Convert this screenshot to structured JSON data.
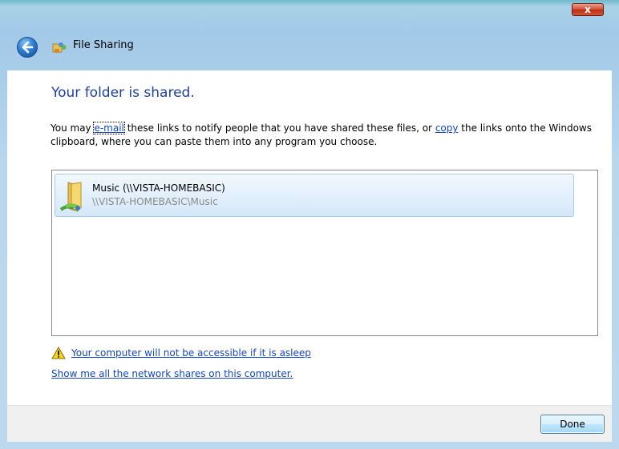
{
  "window": {
    "title": "File Sharing",
    "close_label": "x"
  },
  "main": {
    "heading": "Your folder is shared.",
    "description": {
      "part1": "You may ",
      "email_link": "e-mail",
      "part2": " these links to notify people that you have shared these files, or ",
      "copy_link": "copy",
      "part3": " the links onto the Windows clipboard, where you can paste them into any program you choose."
    },
    "shared_items": [
      {
        "name": "Music (\\\\VISTA-HOMEBASIC)",
        "path": "\\\\VISTA-HOMEBASIC\\Music",
        "icon": "shared-folder-icon"
      }
    ],
    "warning_link": "Your computer will not be accessible if it is asleep",
    "shares_link": "Show me all the network shares on this computer."
  },
  "footer": {
    "done_label": "Done"
  },
  "colors": {
    "heading": "#1e3f9e",
    "link": "#1346c0",
    "chrome": "#a9d2e8"
  }
}
